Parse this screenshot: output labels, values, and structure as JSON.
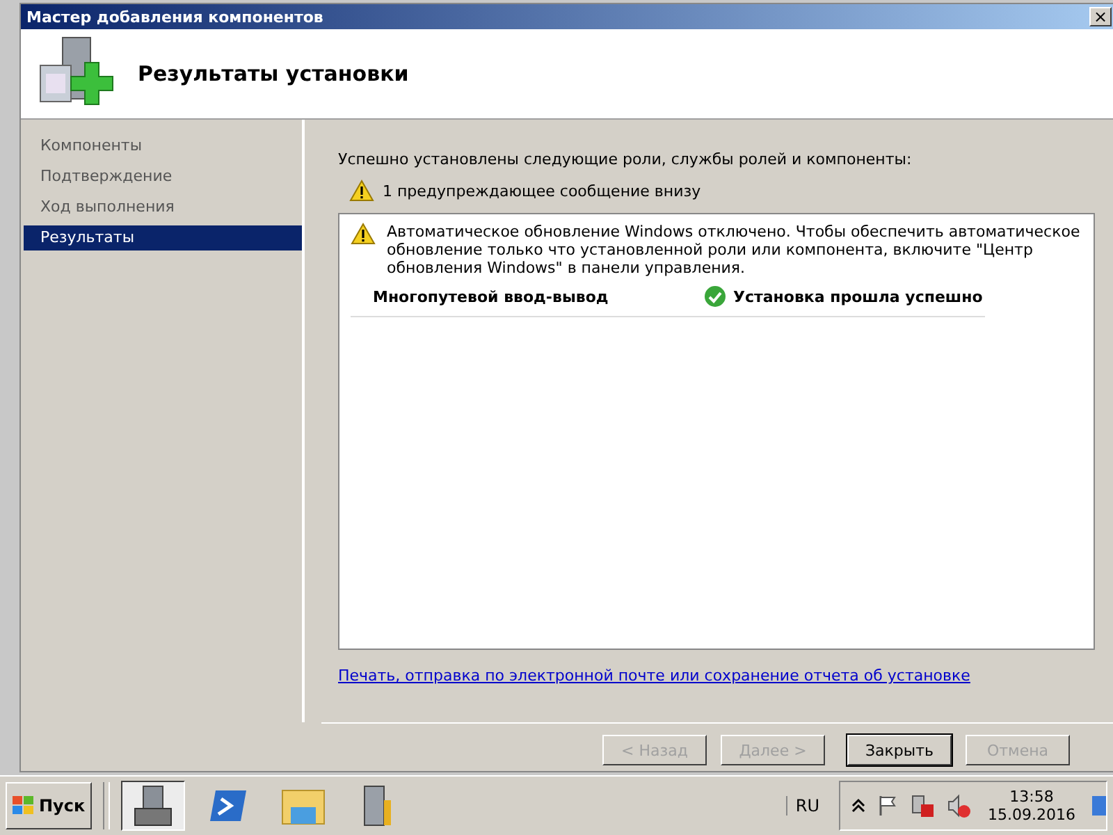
{
  "window": {
    "title": "Мастер добавления компонентов",
    "close": "×"
  },
  "header": {
    "title": "Результаты установки"
  },
  "steps": [
    {
      "label": "Компоненты",
      "selected": false
    },
    {
      "label": "Подтверждение",
      "selected": false
    },
    {
      "label": "Ход выполнения",
      "selected": false
    },
    {
      "label": "Результаты",
      "selected": true
    }
  ],
  "content": {
    "intro": "Успешно установлены следующие роли, службы ролей и компоненты:",
    "warning_summary": "1 предупреждающее сообщение внизу",
    "results": {
      "warning": "Автоматическое обновление Windows отключено. Чтобы обеспечить автоматическое обновление только что установленной роли или компонента, включите \"Центр обновления Windows\" в панели управления.",
      "items": [
        {
          "name": "Многопутевой ввод-вывод",
          "status": "Установка прошла успешно",
          "kind": "success"
        }
      ]
    },
    "report_link": "Печать, отправка по электронной почте или сохранение отчета об установке"
  },
  "buttons": [
    {
      "label": "< Назад",
      "disabled": true
    },
    {
      "label": "Далее >",
      "disabled": true
    },
    {
      "label": "Закрыть",
      "disabled": false
    },
    {
      "label": "Отмена",
      "disabled": true
    }
  ],
  "taskbar": {
    "start": "Пуск",
    "apps": [
      {
        "kind": "server",
        "selected": true
      },
      {
        "kind": "shell",
        "selected": false
      },
      {
        "kind": "folder",
        "selected": false
      },
      {
        "kind": "tools",
        "selected": false
      }
    ],
    "language": "RU",
    "time": "13:58",
    "date": "15.09.2016"
  }
}
